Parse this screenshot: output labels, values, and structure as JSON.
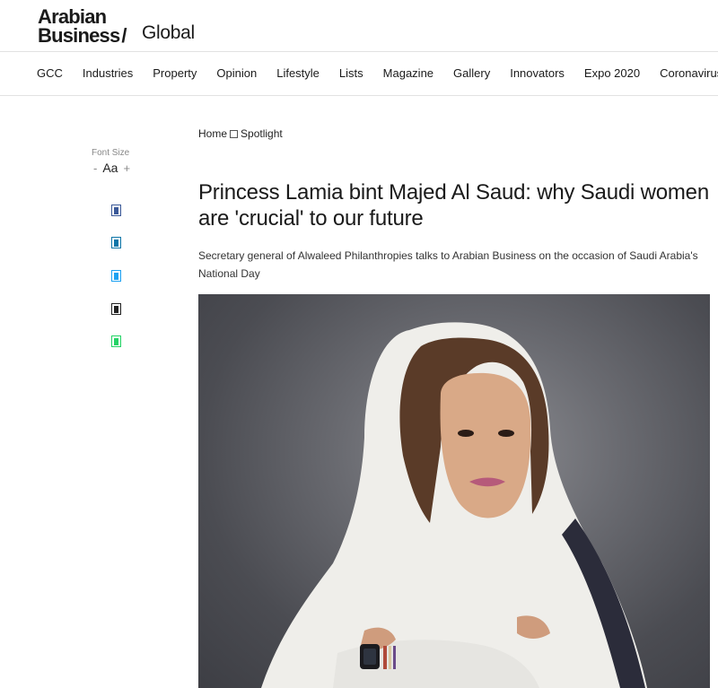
{
  "header": {
    "logo_line1": "Arabian",
    "logo_line2": "Business",
    "logo_slash": "/",
    "edition": "Global"
  },
  "nav": {
    "items": [
      "GCC",
      "Industries",
      "Property",
      "Opinion",
      "Lifestyle",
      "Lists",
      "Magazine",
      "Gallery",
      "Innovators",
      "Expo 2020",
      "Coronavirus"
    ]
  },
  "tools": {
    "font_size_label": "Font Size",
    "font_minus": "-",
    "font_aa": "Aa",
    "font_plus": "+",
    "share_icons": [
      "facebook-icon",
      "linkedin-icon",
      "twitter-icon",
      "email-icon",
      "whatsapp-icon"
    ]
  },
  "article": {
    "breadcrumb": {
      "home": "Home",
      "section": "Spotlight"
    },
    "headline": "Princess Lamia bint Majed Al Saud: why Saudi women are 'crucial' to our future",
    "subhead": "Secretary general of Alwaleed Philanthropies talks to Arabian Business on the occasion of Saudi Arabia's National Day"
  },
  "colors": {
    "text": "#1a1a1a",
    "border": "#e2e2e2",
    "hero_bg": "#5a5b61"
  }
}
